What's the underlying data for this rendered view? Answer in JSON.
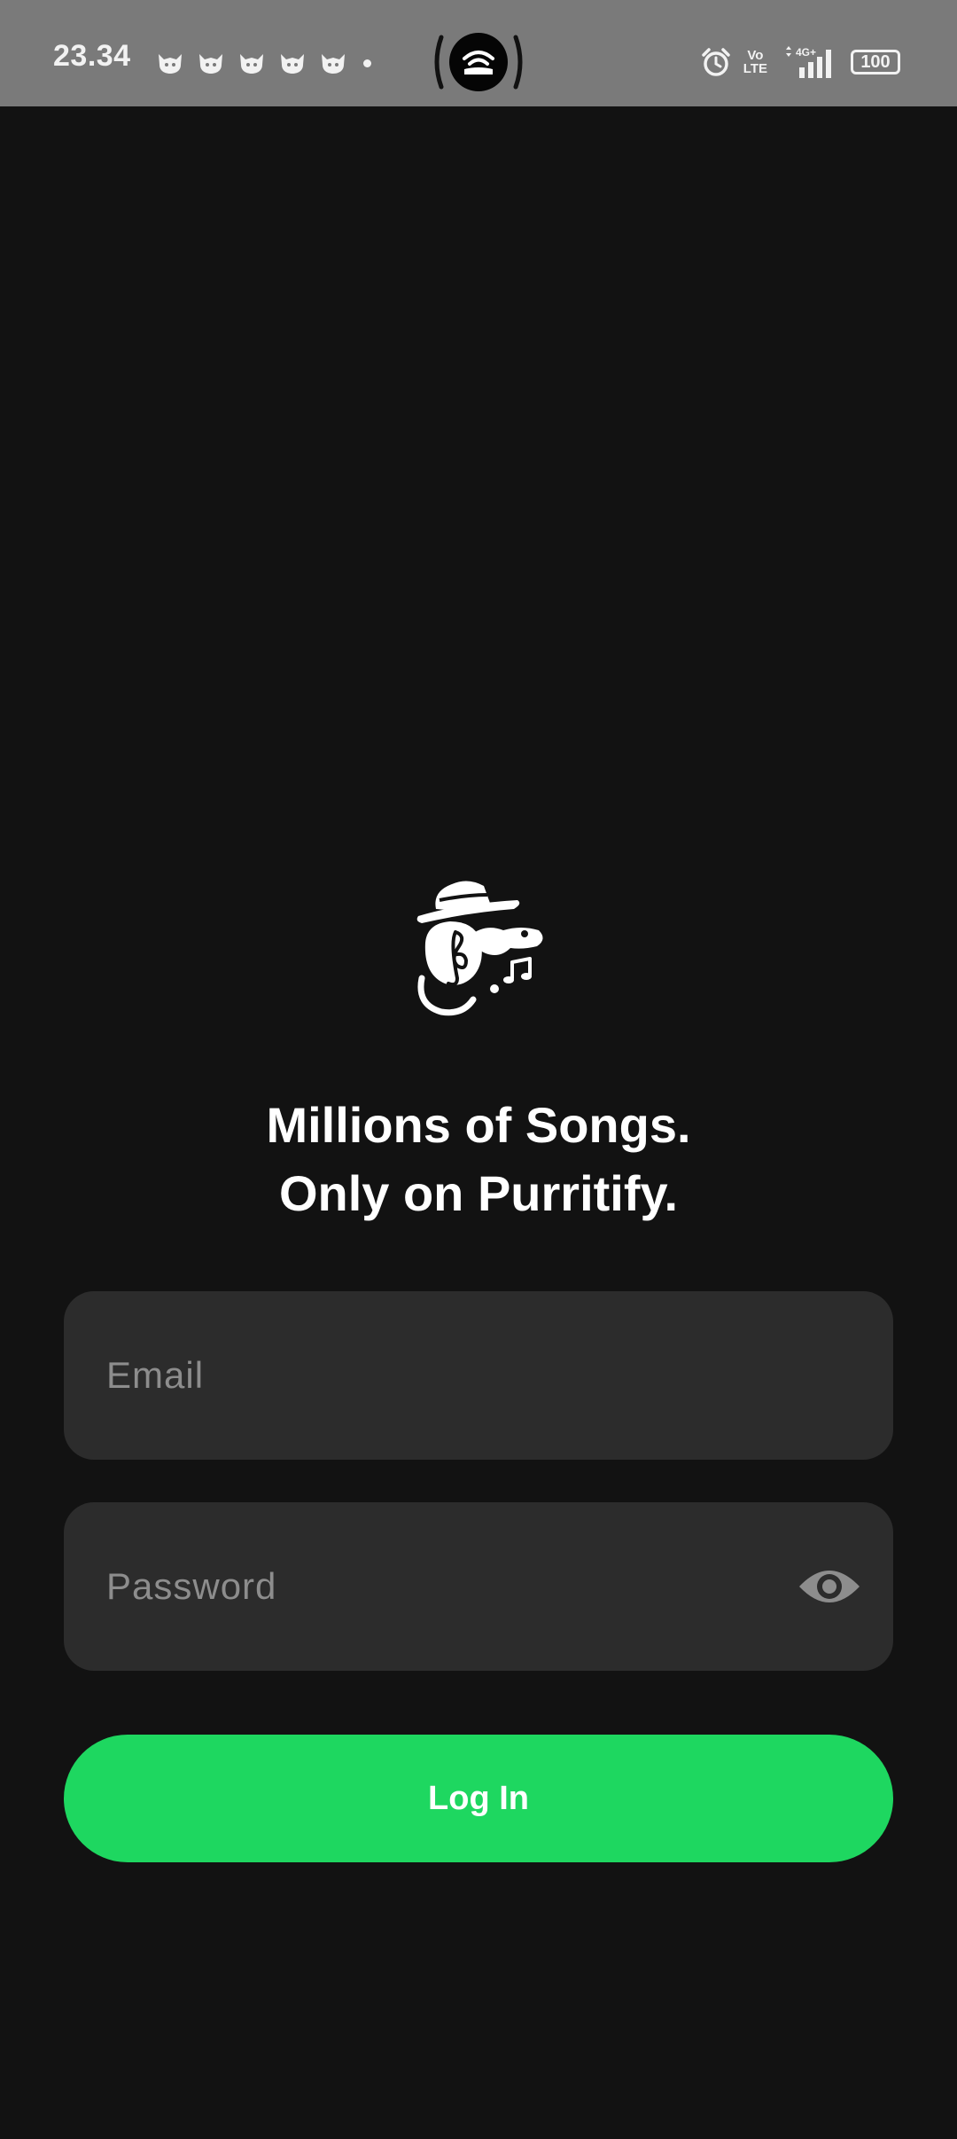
{
  "status_bar": {
    "time": "23.34",
    "network_label": "Vo\nLTE",
    "network_type": "4G+",
    "battery_level": "100",
    "icons": [
      "cat-notification-icon",
      "cat-notification-icon",
      "cat-notification-icon",
      "cat-notification-icon",
      "cat-notification-icon",
      "more-dot-icon",
      "hotspot-icon",
      "alarm-icon",
      "volte-icon",
      "signal-icon",
      "battery-icon"
    ]
  },
  "branding": {
    "logo_icon": "cat-with-hat-music-logo",
    "tagline_line1": "Millions of Songs.",
    "tagline_line2": "Only on Purritify."
  },
  "form": {
    "email": {
      "value": "",
      "placeholder": "Email"
    },
    "password": {
      "value": "",
      "placeholder": "Password",
      "toggle_icon": "eye-icon"
    },
    "login_label": "Log In"
  },
  "colors": {
    "background": "#121212",
    "status_bar": "#7a7a7a",
    "field_background": "#2c2c2c",
    "placeholder": "#8d8d8d",
    "accent": "#1ed760",
    "text": "#ffffff"
  }
}
